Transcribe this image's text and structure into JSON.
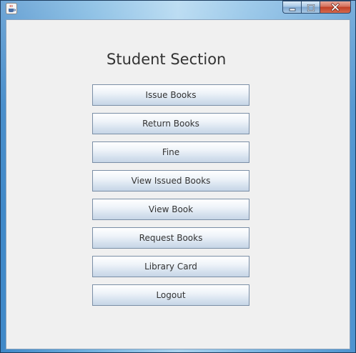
{
  "window": {
    "controls": {
      "minimize_icon": "minimize-icon",
      "maximize_icon": "maximize-icon",
      "close_icon": "close-icon"
    },
    "app_icon": "java-cup-icon"
  },
  "main": {
    "title": "Student Section",
    "buttons": [
      {
        "label": "Issue Books"
      },
      {
        "label": "Return Books"
      },
      {
        "label": "Fine"
      },
      {
        "label": "View Issued Books"
      },
      {
        "label": "View Book"
      },
      {
        "label": "Request Books"
      },
      {
        "label": "Library Card"
      },
      {
        "label": "Logout"
      }
    ]
  },
  "colors": {
    "panel_background": "#f0f0f0",
    "button_border": "#7a8ea6",
    "close_button": "#c23f25"
  }
}
